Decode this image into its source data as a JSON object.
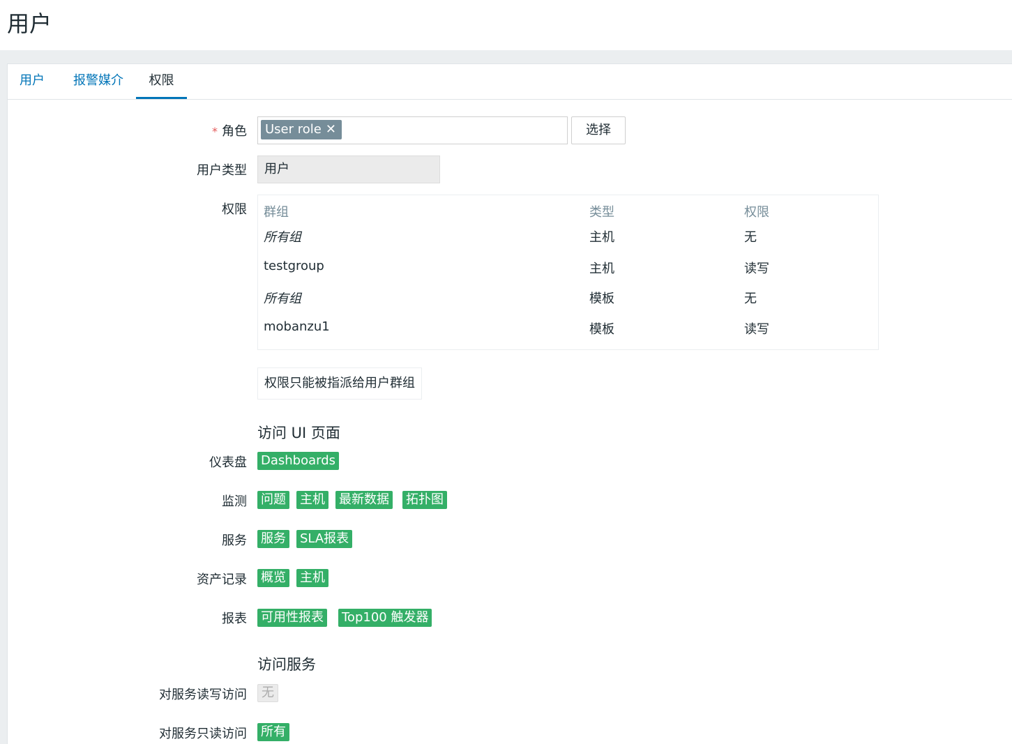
{
  "page": {
    "title": "用户"
  },
  "tabs": [
    {
      "label": "用户"
    },
    {
      "label": "报警媒介"
    },
    {
      "label": "权限"
    }
  ],
  "form": {
    "role": {
      "label": "角色",
      "chip": "User role",
      "select_button": "选择"
    },
    "user_type": {
      "label": "用户类型",
      "value": "用户"
    },
    "permissions": {
      "label": "权限",
      "headers": [
        "群组",
        "类型",
        "权限"
      ],
      "rows": [
        {
          "group": "所有组",
          "type": "主机",
          "permission": "无"
        },
        {
          "group": "testgroup",
          "type": "主机",
          "permission": "读写"
        },
        {
          "group": "所有组",
          "type": "模板",
          "permission": "无"
        },
        {
          "group": "mobanzu1",
          "type": "模板",
          "permission": "读写"
        }
      ],
      "note": "权限只能被指派给用户群组"
    },
    "ui_access": {
      "title": "访问 UI 页面",
      "groups": [
        {
          "label": "仪表盘",
          "tags": [
            "Dashboards"
          ]
        },
        {
          "label": "监测",
          "tags": [
            "问题",
            "主机",
            "最新数据",
            "拓扑图"
          ]
        },
        {
          "label": "服务",
          "tags": [
            "服务",
            "SLA报表"
          ]
        },
        {
          "label": "资产记录",
          "tags": [
            "概览",
            "主机"
          ]
        },
        {
          "label": "报表",
          "tags": [
            "可用性报表",
            "Top100 触发器"
          ]
        }
      ]
    },
    "service_access": {
      "title": "访问服务",
      "read_write": {
        "label": "对服务读写访问",
        "value": "无"
      },
      "read_only": {
        "label": "对服务只读访问",
        "value": "所有"
      }
    }
  },
  "colors": {
    "accent": "#0275b8",
    "tag_green": "#34af67",
    "chip_gray": "#768d99",
    "required": "#e45959"
  }
}
